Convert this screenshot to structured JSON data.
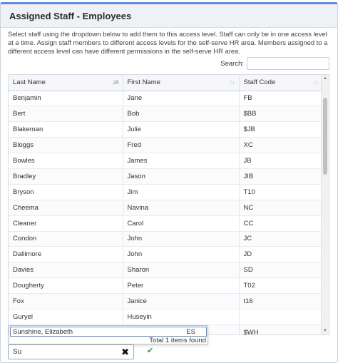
{
  "panel": {
    "title": "Assigned Staff - Employees",
    "intro": "Select staff using the dropdown below to add them to this access level. Staff can only be in one access level at a time. Assign staff members to different access levels for the self-serve HR area. Members assigned to a different access level can have different permissions in the self-serve HR area."
  },
  "search": {
    "label": "Search:",
    "value": ""
  },
  "table": {
    "columns": [
      "Last Name",
      "First Name",
      "Staff Code"
    ],
    "rows": [
      [
        "Benjamin",
        "Jane",
        "FB"
      ],
      [
        "Bert",
        "Bob",
        "$BB"
      ],
      [
        "Blakeman",
        "Julie",
        "$JB"
      ],
      [
        "Bloggs",
        "Fred",
        "XC"
      ],
      [
        "Bowles",
        "James",
        "JB"
      ],
      [
        "Bradley",
        "Jason",
        "JIB"
      ],
      [
        "Bryson",
        "Jim",
        "T10"
      ],
      [
        "Cheema",
        "Navina",
        "NC"
      ],
      [
        "Cleaner",
        "Carol",
        "CC"
      ],
      [
        "Condon",
        "John",
        "JC"
      ],
      [
        "Dallimore",
        "John",
        "JD"
      ],
      [
        "Davies",
        "Sharon",
        "SD"
      ],
      [
        "Dougherty",
        "Peter",
        "T02"
      ],
      [
        "Fox",
        "Janice",
        "t16"
      ],
      [
        "Guryel",
        "Huseyin",
        ""
      ],
      [
        "",
        "",
        "$WH"
      ]
    ]
  },
  "dropdown": {
    "option_name": "Sunshine, Elizabeth",
    "option_code": "ES",
    "footer": "Total 1 items found"
  },
  "add_staff": {
    "value": "Su"
  },
  "icons": {
    "sort_active": "sort-alpha-down-icon",
    "sort": "sort-icon",
    "clear": "clear-icon",
    "confirm": "check-icon"
  },
  "colors": {
    "accent": "#5b8fd6",
    "header_bg": "#eef1f6",
    "confirm": "#2e9a4a"
  }
}
